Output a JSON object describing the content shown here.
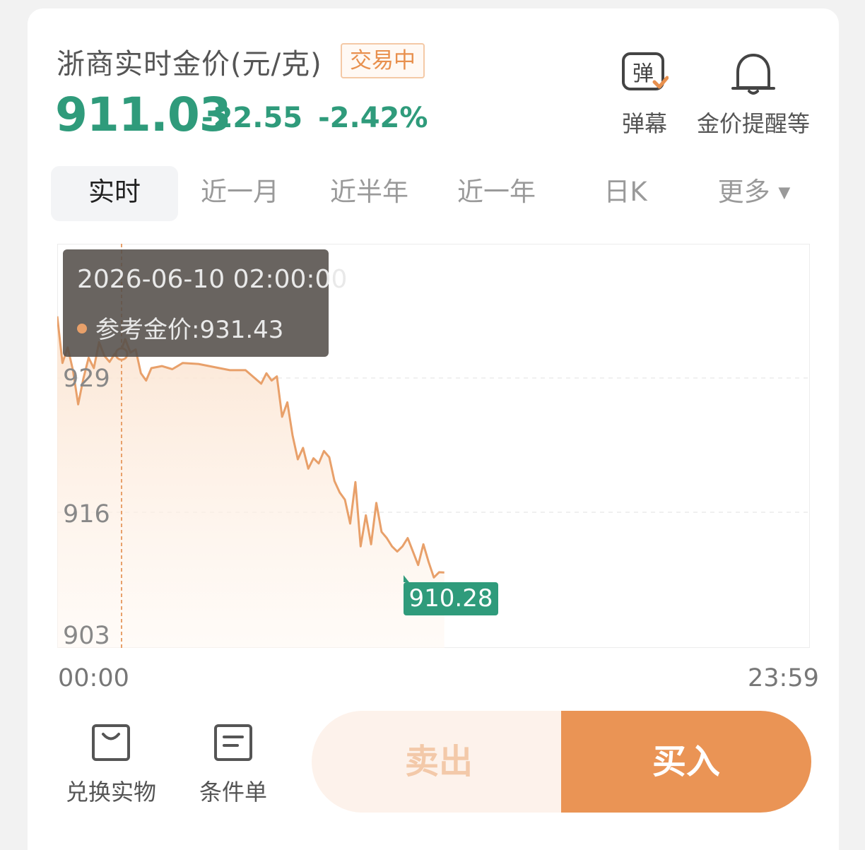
{
  "header": {
    "title": "浙商实时金价(元/克)",
    "status_badge": "交易中",
    "price": "911.03",
    "change": "-22.55",
    "change_pct": "-2.42%"
  },
  "tools": {
    "danmu_label": "弹幕",
    "danmu_icon_text": "弹",
    "alert_label": "金价提醒等"
  },
  "tabs": [
    "实时",
    "近一月",
    "近半年",
    "近一年",
    "日K",
    "更多"
  ],
  "tooltip": {
    "time": "2026-06-10 02:00:00",
    "label": "参考金价:931.43"
  },
  "current_tag": "910.28",
  "chart_data": {
    "type": "line",
    "x_start": "00:00",
    "x_end": "23:59",
    "y_ticks": [
      "929",
      "916",
      "903"
    ],
    "ylim": [
      903,
      942
    ],
    "accent_color": "#e8a06a",
    "x": [
      "00:00",
      "00:10",
      "00:20",
      "00:30",
      "00:40",
      "00:50",
      "01:00",
      "01:10",
      "01:20",
      "01:30",
      "01:40",
      "01:50",
      "02:00",
      "02:10",
      "02:20",
      "02:30",
      "02:40",
      "02:50",
      "03:00",
      "03:20",
      "03:40",
      "04:00",
      "04:30",
      "05:00",
      "05:30",
      "06:00",
      "06:30",
      "06:40",
      "06:50",
      "07:00",
      "07:10",
      "07:20",
      "07:30",
      "07:40",
      "07:50",
      "08:00",
      "08:10",
      "08:20",
      "08:30",
      "08:40",
      "08:50",
      "09:00",
      "09:10",
      "09:20",
      "09:30",
      "09:40",
      "09:50",
      "10:00",
      "10:10",
      "10:20",
      "10:30",
      "10:40",
      "10:50",
      "11:00",
      "11:10",
      "11:20",
      "11:30",
      "11:40",
      "11:50",
      "12:00",
      "12:10",
      "12:20"
    ],
    "values": [
      935,
      930.5,
      932,
      929.8,
      926.5,
      929,
      931,
      930,
      932.5,
      931.2,
      930.6,
      931.4,
      931.43,
      932.8,
      931.5,
      931.8,
      929.5,
      928.8,
      930.0,
      930.2,
      929.9,
      930.5,
      930.4,
      930.1,
      929.8,
      929.8,
      928.5,
      929.5,
      928.8,
      929.2,
      925.3,
      926.7,
      923.5,
      921.2,
      922.3,
      920.3,
      921.3,
      920.8,
      922.0,
      921.4,
      919.1,
      918.0,
      917.3,
      915.0,
      919.0,
      912.8,
      915.8,
      913.0,
      917.0,
      914.2,
      913.6,
      912.8,
      912.3,
      912.8,
      913.6,
      912.3,
      911.0,
      913.0,
      911.3,
      909.8,
      910.3,
      910.28
    ]
  },
  "bottom": {
    "exchange_label": "兑换实物",
    "condition_label": "条件单",
    "sell_label": "卖出",
    "buy_label": "买入"
  }
}
